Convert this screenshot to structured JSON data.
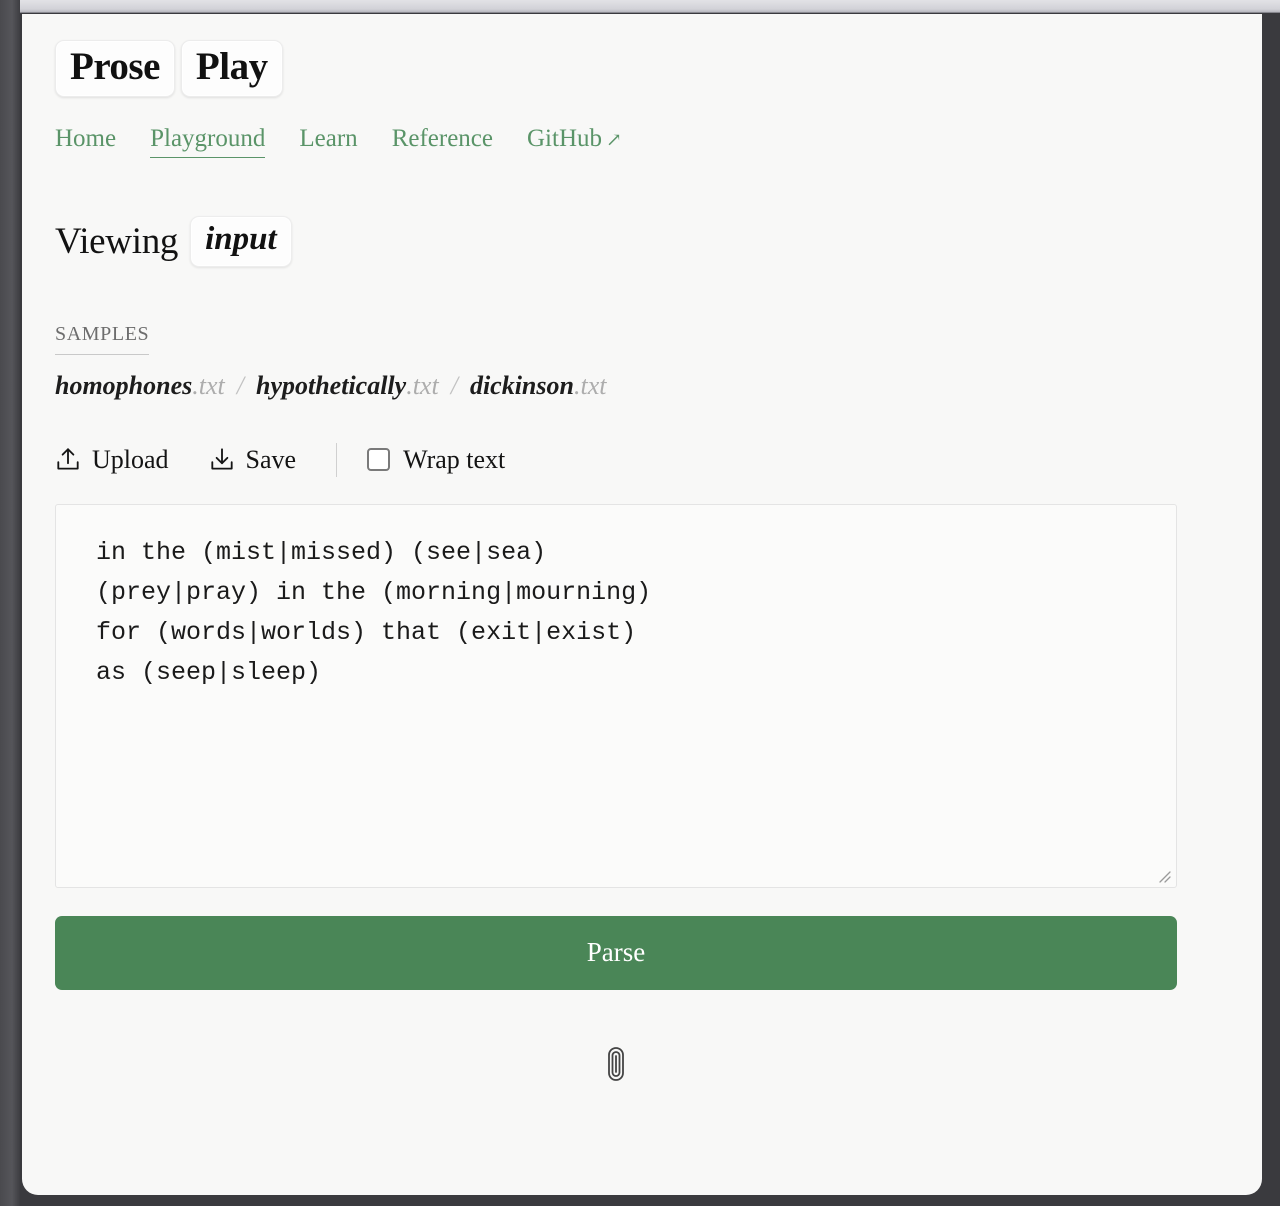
{
  "logo": {
    "part1": "Prose",
    "part2": "Play"
  },
  "nav": {
    "items": [
      {
        "label": "Home",
        "active": false,
        "external": false
      },
      {
        "label": "Playground",
        "active": true,
        "external": false
      },
      {
        "label": "Learn",
        "active": false,
        "external": false
      },
      {
        "label": "Reference",
        "active": false,
        "external": false
      },
      {
        "label": "GitHub",
        "active": false,
        "external": true
      }
    ],
    "external_arrow": "↗",
    "link_color": "#5a9468"
  },
  "heading": {
    "label": "Viewing",
    "mode": "input"
  },
  "samples": {
    "label": "SAMPLES",
    "separator": "/",
    "files": [
      {
        "name": "homophones",
        "ext": ".txt"
      },
      {
        "name": "hypothetically",
        "ext": ".txt"
      },
      {
        "name": "dickinson",
        "ext": ".txt"
      }
    ]
  },
  "toolbar": {
    "upload_label": "Upload",
    "upload_icon": "upload-icon",
    "save_label": "Save",
    "save_icon": "download-icon",
    "wrap_label": "Wrap text",
    "wrap_checked": false
  },
  "editor": {
    "content": "in the (mist|missed) (see|sea)\n(prey|pray) in the (morning|mourning)\nfor (words|worlds) that (exit|exist)\nas (seep|sleep)",
    "resize_handle": "resize-grip-icon"
  },
  "actions": {
    "parse_label": "Parse",
    "parse_color": "#4a8657"
  },
  "footer": {
    "icon": "paperclip-icon",
    "glyph": "🖇"
  }
}
